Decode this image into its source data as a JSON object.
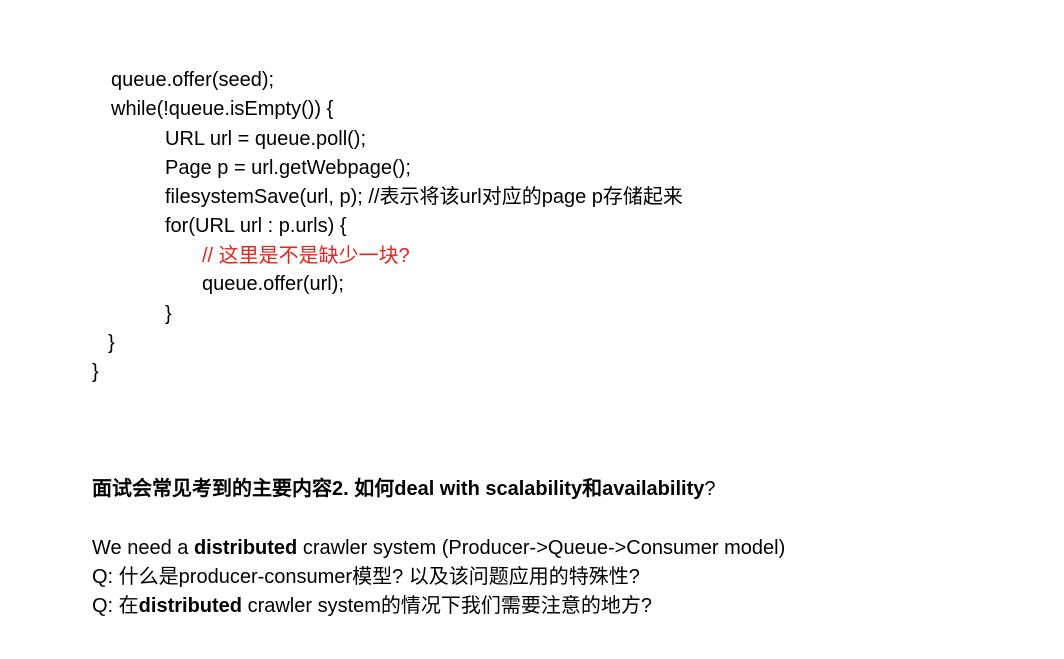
{
  "code": {
    "lines": [
      "queue.offer(seed);",
      "while(!queue.isEmpty()) {",
      "URL url = queue.poll();",
      "Page p = url.getWebpage();",
      "filesystemSave(url, p); //表示将该url对应的page p存储起来",
      "for(URL url : p.urls) {",
      "// 这里是不是缺少一块?",
      "queue.offer(url);",
      "}",
      "}",
      "}"
    ],
    "comment_color": "#e8231b"
  },
  "heading": {
    "bold_text": "面试会常见考到的主要内容2. 如何deal with scalability和availability",
    "trailing": "?"
  },
  "body": {
    "line1": {
      "pre": "We need a ",
      "bold": "distributed",
      "post": " crawler system (Producer->Queue->Consumer model)"
    },
    "line2": {
      "text": "Q: 什么是producer-consumer模型? 以及该问题应用的特殊性?"
    },
    "line3": {
      "pre": "Q: 在",
      "bold": "distributed",
      "post": " crawler system的情况下我们需要注意的地方?"
    }
  }
}
